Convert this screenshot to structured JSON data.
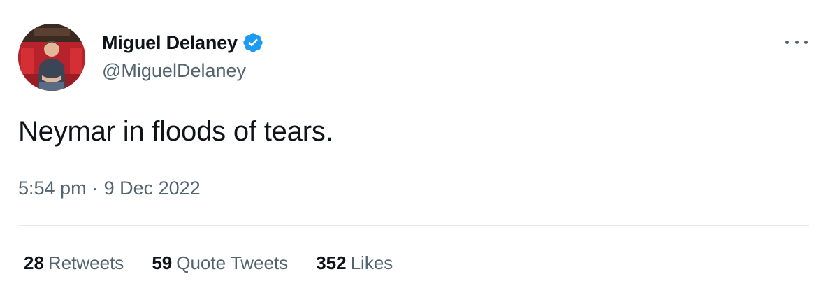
{
  "author": {
    "display_name": "Miguel Delaney",
    "handle": "@MiguelDelaney",
    "verified_icon": "verified-badge-icon",
    "verified_color": "#1d9bf0"
  },
  "tweet": {
    "text": "Neymar in floods of tears.",
    "time": "5:54 pm",
    "separator": "·",
    "date": "9 Dec 2022"
  },
  "stats": [
    {
      "count": "28",
      "label": "Retweets"
    },
    {
      "count": "59",
      "label": "Quote Tweets"
    },
    {
      "count": "352",
      "label": "Likes"
    }
  ],
  "menu_icon": "more-options-icon",
  "colors": {
    "text_primary": "#0f1419",
    "text_secondary": "#536471",
    "divider": "#e5e9ec"
  }
}
